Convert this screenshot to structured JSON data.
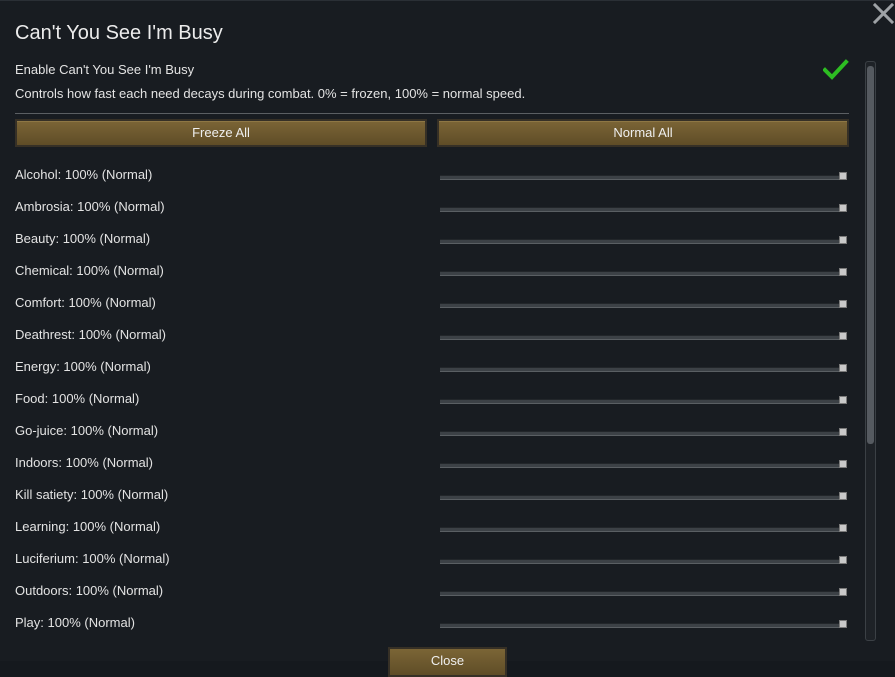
{
  "dialog": {
    "title": "Can't You See I'm Busy",
    "enable_label": "Enable Can't You See I'm Busy",
    "enable_checked": true,
    "description": "Controls how fast each need decays during combat. 0% = frozen, 100% = normal speed.",
    "freeze_all_label": "Freeze All",
    "normal_all_label": "Normal All",
    "close_button_label": "Close",
    "close_icon": "close-x-icon",
    "checkmark_icon": "checkmark-icon",
    "accent_color": "#2dbd22",
    "button_color": "#6d5a2f"
  },
  "needs": [
    {
      "label": "Alcohol: 100% (Normal)",
      "value": 1.0
    },
    {
      "label": "Ambrosia: 100% (Normal)",
      "value": 1.0
    },
    {
      "label": "Beauty: 100% (Normal)",
      "value": 1.0
    },
    {
      "label": "Chemical: 100% (Normal)",
      "value": 1.0
    },
    {
      "label": "Comfort: 100% (Normal)",
      "value": 1.0
    },
    {
      "label": "Deathrest: 100% (Normal)",
      "value": 1.0
    },
    {
      "label": "Energy: 100% (Normal)",
      "value": 1.0
    },
    {
      "label": "Food: 100% (Normal)",
      "value": 1.0
    },
    {
      "label": "Go-juice: 100% (Normal)",
      "value": 1.0
    },
    {
      "label": "Indoors: 100% (Normal)",
      "value": 1.0
    },
    {
      "label": "Kill satiety: 100% (Normal)",
      "value": 1.0
    },
    {
      "label": "Learning: 100% (Normal)",
      "value": 1.0
    },
    {
      "label": "Luciferium: 100% (Normal)",
      "value": 1.0
    },
    {
      "label": "Outdoors: 100% (Normal)",
      "value": 1.0
    },
    {
      "label": "Play: 100% (Normal)",
      "value": 1.0
    }
  ]
}
